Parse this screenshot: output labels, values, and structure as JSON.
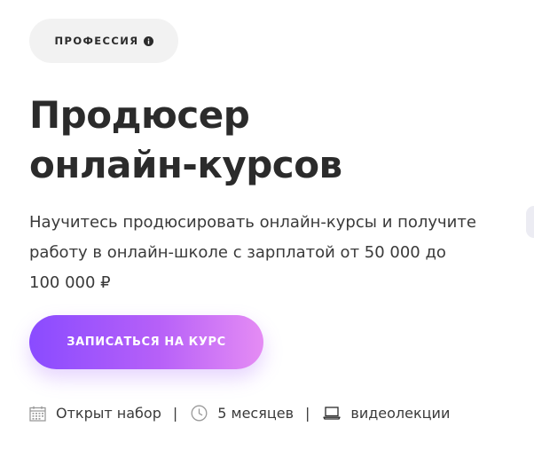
{
  "badge": {
    "label": "ПРОФЕССИЯ",
    "icon": "info-icon"
  },
  "course": {
    "title_line1": "Продюсер",
    "title_line2": "онлайн-курсов",
    "description_line1": "Научитесь продюсировать онлайн-курсы и получите",
    "description_line2": "работу в онлайн-школе с зарплатой от 50 000 до",
    "description_line3": "100 000 ₽"
  },
  "cta": {
    "label": "ЗАПИСАТЬСЯ НА КУРС",
    "gradient_start": "#8a4bff",
    "gradient_end": "#e58cf4"
  },
  "meta": {
    "enrollment": {
      "icon": "calendar-icon",
      "label": "Открыт набор"
    },
    "duration": {
      "icon": "clock-icon",
      "label": "5 месяцев"
    },
    "format": {
      "icon": "laptop-icon",
      "label": "видеолекции"
    },
    "separator": "|"
  },
  "colors": {
    "text": "#2b2b2b",
    "badge_bg": "#f2f2f2",
    "icon": "#9a9a9a"
  }
}
